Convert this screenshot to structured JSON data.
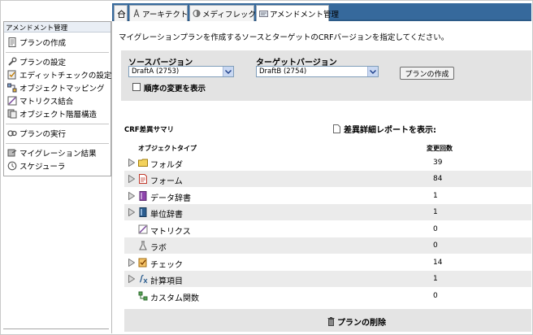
{
  "tabs": [
    {
      "label": "",
      "icon": "home-icon"
    },
    {
      "label": "アーキテクト",
      "icon": "architect-icon"
    },
    {
      "label": "メディフレックス",
      "icon": "mediflex-icon"
    },
    {
      "label": "アメンドメント管理",
      "icon": "amendment-icon",
      "active": true
    }
  ],
  "sidebar": {
    "header": "アメンドメント管理",
    "items": [
      {
        "label": "プランの作成",
        "icon": "document-icon"
      },
      {
        "label": "プランの設定",
        "icon": "wrench-icon"
      },
      {
        "label": "エディットチェックの設定",
        "icon": "edit-check-icon"
      },
      {
        "label": "オブジェクトマッピング",
        "icon": "mapping-icon"
      },
      {
        "label": "マトリクス結合",
        "icon": "matrix-icon"
      },
      {
        "label": "オブジェクト階層構造",
        "icon": "hierarchy-icon"
      },
      {
        "label": "プランの実行",
        "icon": "run-icon"
      },
      {
        "label": "マイグレーション結果",
        "icon": "results-icon"
      },
      {
        "label": "スケジューラ",
        "icon": "scheduler-icon"
      }
    ]
  },
  "main": {
    "instruction": "マイグレーションプランを作成するソースとターゲットのCRFバージョンを指定してください。",
    "source_label": "ソースバージョン",
    "source_value": "DraftA (2753)",
    "target_label": "ターゲットバージョン",
    "target_value": "DraftB (2754)",
    "create_button": "プランの作成",
    "show_changes_label": "順序の変更を表示",
    "summary_title": "CRF差異サマリ",
    "report_link": "差異詳細レポートを表示:",
    "col_type": "オブジェクトタイプ",
    "col_count": "変更回数",
    "rows": [
      {
        "label": "フォルダ",
        "count": "39",
        "icon": "folder-icon",
        "expandable": true
      },
      {
        "label": "フォーム",
        "count": "84",
        "icon": "form-icon",
        "expandable": true
      },
      {
        "label": "データ辞書",
        "count": "1",
        "icon": "data-dictionary-icon",
        "expandable": true
      },
      {
        "label": "単位辞書",
        "count": "1",
        "icon": "unit-dictionary-icon",
        "expandable": true
      },
      {
        "label": "マトリクス",
        "count": "0",
        "icon": "matrix-icon",
        "expandable": false
      },
      {
        "label": "ラボ",
        "count": "0",
        "icon": "lab-icon",
        "expandable": false
      },
      {
        "label": "チェック",
        "count": "14",
        "icon": "check-icon",
        "expandable": true
      },
      {
        "label": "計算項目",
        "count": "1",
        "icon": "calculation-icon",
        "expandable": true
      },
      {
        "label": "カスタム関数",
        "count": "0",
        "icon": "custom-function-icon",
        "expandable": false
      }
    ],
    "delete_button": "プランの削除"
  },
  "colors": {
    "tabbar": "#36699c",
    "panel": "#e3e3e3",
    "row_alt": "#ebebeb"
  }
}
